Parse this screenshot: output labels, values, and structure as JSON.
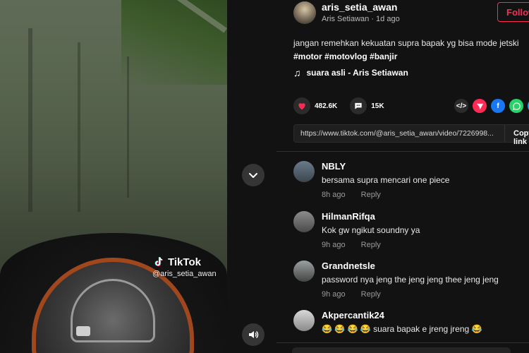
{
  "video": {
    "watermark_brand": "TikTok",
    "watermark_user": "@aris_setia_awan",
    "chevron_icon": "chevron-down-icon",
    "volume_icon": "volume-icon"
  },
  "header": {
    "username": "aris_setia_awan",
    "display_name": "Aris Setiawan",
    "separator": " · ",
    "posted": "1d ago",
    "follow_label": "Follow"
  },
  "caption": {
    "text": "jangan remehkan kekuatan supra bapak yg bisa mode jetski",
    "hashtags": [
      "#motor",
      "#motovlog",
      "#banjir"
    ]
  },
  "sound": {
    "label": "suara asli - Aris Setiawan"
  },
  "actions": {
    "likes": "482.6K",
    "comments": "15K"
  },
  "share_icons": [
    "embed-icon",
    "send-icon",
    "facebook-icon",
    "whatsapp-icon",
    "share-more-icon"
  ],
  "link": {
    "url": "https://www.tiktok.com/@aris_setia_awan/video/7226998...",
    "copy_label": "Copy link"
  },
  "comments": [
    {
      "name": "NBLY",
      "text": "bersama supra mencari one piece",
      "time": "8h ago",
      "reply": "Reply"
    },
    {
      "name": "HilmanRifqa",
      "text": "Kok gw ngikut soundny ya",
      "time": "9h ago",
      "reply": "Reply"
    },
    {
      "name": "Grandnetsle",
      "text": "password nya jeng the jeng jeng thee jeng jeng",
      "time": "9h ago",
      "reply": "Reply"
    },
    {
      "name": "Akpercantik24",
      "text": "😂 😂 😂 😂  suara bapak e jreng jreng 😂",
      "time": "",
      "reply": ""
    }
  ],
  "colors": {
    "accent": "#fe2c55",
    "like": "#fe2c55",
    "background": "#121212"
  }
}
